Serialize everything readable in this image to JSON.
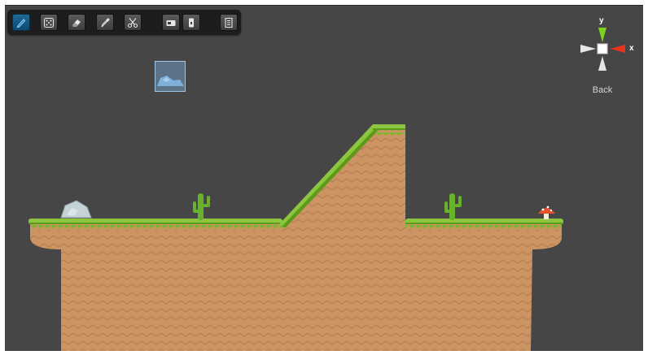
{
  "toolbar": {
    "tools": [
      {
        "icon": "pencil-icon",
        "active": true
      },
      {
        "icon": "dice-icon",
        "active": false
      },
      {
        "icon": "eraser-icon",
        "active": false
      },
      {
        "icon": "eyedropper-icon",
        "active": false
      },
      {
        "icon": "scissors-icon",
        "active": false
      },
      {
        "icon": "camera-icon",
        "active": false
      },
      {
        "icon": "door-icon",
        "active": false
      },
      {
        "icon": "page-icon",
        "active": false
      }
    ]
  },
  "gizmo": {
    "y_label": "y",
    "x_label": "x",
    "view_label": "Back",
    "colors": {
      "y_axis": "#7ed321",
      "x_axis": "#e5351c",
      "neutral": "#e6e6e6"
    }
  },
  "scene": {
    "colors": {
      "background": "#464646",
      "dirt": "#cc9462",
      "dirt_pattern": "#b77f52",
      "grass": "#8cc63f",
      "grass_dark": "#5e9a1a",
      "cactus": "#66b22a",
      "rock": "#c5d3d6",
      "mushroom_cap": "#e8522a",
      "selection": "#9fc7ec"
    }
  }
}
